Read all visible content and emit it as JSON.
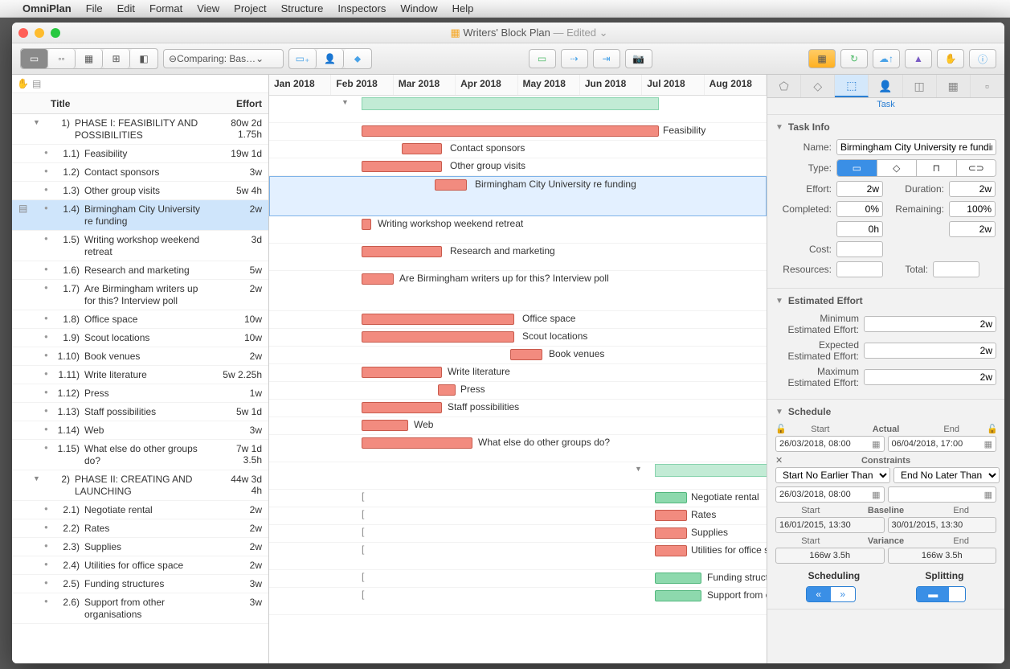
{
  "menubar": {
    "app": "OmniPlan",
    "items": [
      "File",
      "Edit",
      "Format",
      "View",
      "Project",
      "Structure",
      "Inspectors",
      "Window",
      "Help"
    ]
  },
  "window": {
    "title": "Writers' Block Plan",
    "status": "— Edited"
  },
  "toolbar": {
    "comparing": "Comparing: Bas…"
  },
  "outline": {
    "headers": {
      "title": "Title",
      "effort": "Effort"
    },
    "rows": [
      {
        "class": "phase1",
        "tri": "▼",
        "num": "1)",
        "title": "PHASE I: FEASIBILITY AND POSSIBILITIES",
        "effort": "80w 2d\n1.75h"
      },
      {
        "num": "1.1)",
        "title": "Feasibility",
        "effort": "19w 1d"
      },
      {
        "num": "1.2)",
        "title": "Contact sponsors",
        "effort": "3w"
      },
      {
        "num": "1.3)",
        "title": "Other group visits",
        "effort": "5w 4h"
      },
      {
        "num": "1.4)",
        "title": "Birmingham City University re funding",
        "effort": "2w",
        "selected": true
      },
      {
        "num": "1.5)",
        "title": "Writing workshop weekend retreat",
        "effort": "3d"
      },
      {
        "num": "1.6)",
        "title": "Research and marketing",
        "effort": "5w"
      },
      {
        "num": "1.7)",
        "title": "Are Birmingham writers up for this? Interview poll",
        "effort": "2w"
      },
      {
        "num": "1.8)",
        "title": "Office space",
        "effort": "10w"
      },
      {
        "num": "1.9)",
        "title": "Scout locations",
        "effort": "10w"
      },
      {
        "num": "1.10)",
        "title": "Book venues",
        "effort": "2w"
      },
      {
        "num": "1.11)",
        "title": "Write literature",
        "effort": "5w 2.25h"
      },
      {
        "num": "1.12)",
        "title": "Press",
        "effort": "1w"
      },
      {
        "num": "1.13)",
        "title": "Staff possibilities",
        "effort": "5w 1d"
      },
      {
        "num": "1.14)",
        "title": "Web",
        "effort": "3w"
      },
      {
        "num": "1.15)",
        "title": "What else do other groups do?",
        "effort": "7w 1d\n3.5h"
      },
      {
        "class": "phase2",
        "tri": "▼",
        "num": "2)",
        "title": "PHASE II: CREATING AND LAUNCHING",
        "effort": "44w 3d\n4h"
      },
      {
        "num": "2.1)",
        "title": "Negotiate rental",
        "effort": "2w"
      },
      {
        "num": "2.2)",
        "title": "Rates",
        "effort": "2w"
      },
      {
        "num": "2.3)",
        "title": "Supplies",
        "effort": "2w"
      },
      {
        "num": "2.4)",
        "title": "Utilities for office space",
        "effort": "2w"
      },
      {
        "num": "2.5)",
        "title": "Funding structures",
        "effort": "3w"
      },
      {
        "num": "2.6)",
        "title": "Support from other organisations",
        "effort": "3w"
      }
    ]
  },
  "gantt": {
    "months": [
      "Jan 2018",
      "Feb 2018",
      "Mar 2018",
      "Apr 2018",
      "May 2018",
      "Jun 2018",
      "Jul 2018",
      "Aug 2018"
    ],
    "labels": {
      "feasibility": "Feasibility",
      "contact": "Contact sponsors",
      "othergroup": "Other group visits",
      "bcu": "Birmingham City University re funding",
      "workshop": "Writing workshop weekend retreat",
      "research": "Research and marketing",
      "poll": "Are Birmingham writers up for this? Interview poll",
      "office": "Office space",
      "scout": "Scout locations",
      "book": "Book venues",
      "lit": "Write literature",
      "press": "Press",
      "staff": "Staff possibilities",
      "web": "Web",
      "whatelse": "What else do other groups do?",
      "negotiate": "Negotiate rental",
      "rates": "Rates",
      "supplies": "Supplies",
      "utilities": "Utilities for office space",
      "funding": "Funding structures",
      "support": "Support from other organisations"
    }
  },
  "inspector": {
    "tab_label": "Task",
    "task_info": {
      "header": "Task Info",
      "name_lbl": "Name:",
      "name": "Birmingham City University re funding",
      "type_lbl": "Type:",
      "effort_lbl": "Effort:",
      "effort": "2w",
      "duration_lbl": "Duration:",
      "duration": "2w",
      "completed_lbl": "Completed:",
      "completed": "0%",
      "remaining_lbl": "Remaining:",
      "remaining": "100%",
      "hours": "0h",
      "rem_dur": "2w",
      "cost_lbl": "Cost:",
      "resources_lbl": "Resources:",
      "total_lbl": "Total:"
    },
    "estimated": {
      "header": "Estimated Effort",
      "min_lbl": "Minimum Estimated Effort:",
      "min": "2w",
      "exp_lbl": "Expected Estimated Effort:",
      "exp": "2w",
      "max_lbl": "Maximum Estimated Effort:",
      "max": "2w"
    },
    "schedule": {
      "header": "Schedule",
      "start": "Start",
      "actual": "Actual",
      "end": "End",
      "start_val": "26/03/2018, 08:00",
      "end_val": "06/04/2018, 17:00",
      "constraints": "Constraints",
      "cons_start": "Start No Earlier Than",
      "cons_end": "End No Later Than",
      "cons_start_val": "26/03/2018, 08:00",
      "baseline": "Baseline",
      "base_start": "16/01/2015, 13:30",
      "base_end": "30/01/2015, 13:30",
      "variance": "Variance",
      "var_start": "166w 3.5h",
      "var_end": "166w 3.5h",
      "scheduling": "Scheduling",
      "splitting": "Splitting"
    }
  }
}
